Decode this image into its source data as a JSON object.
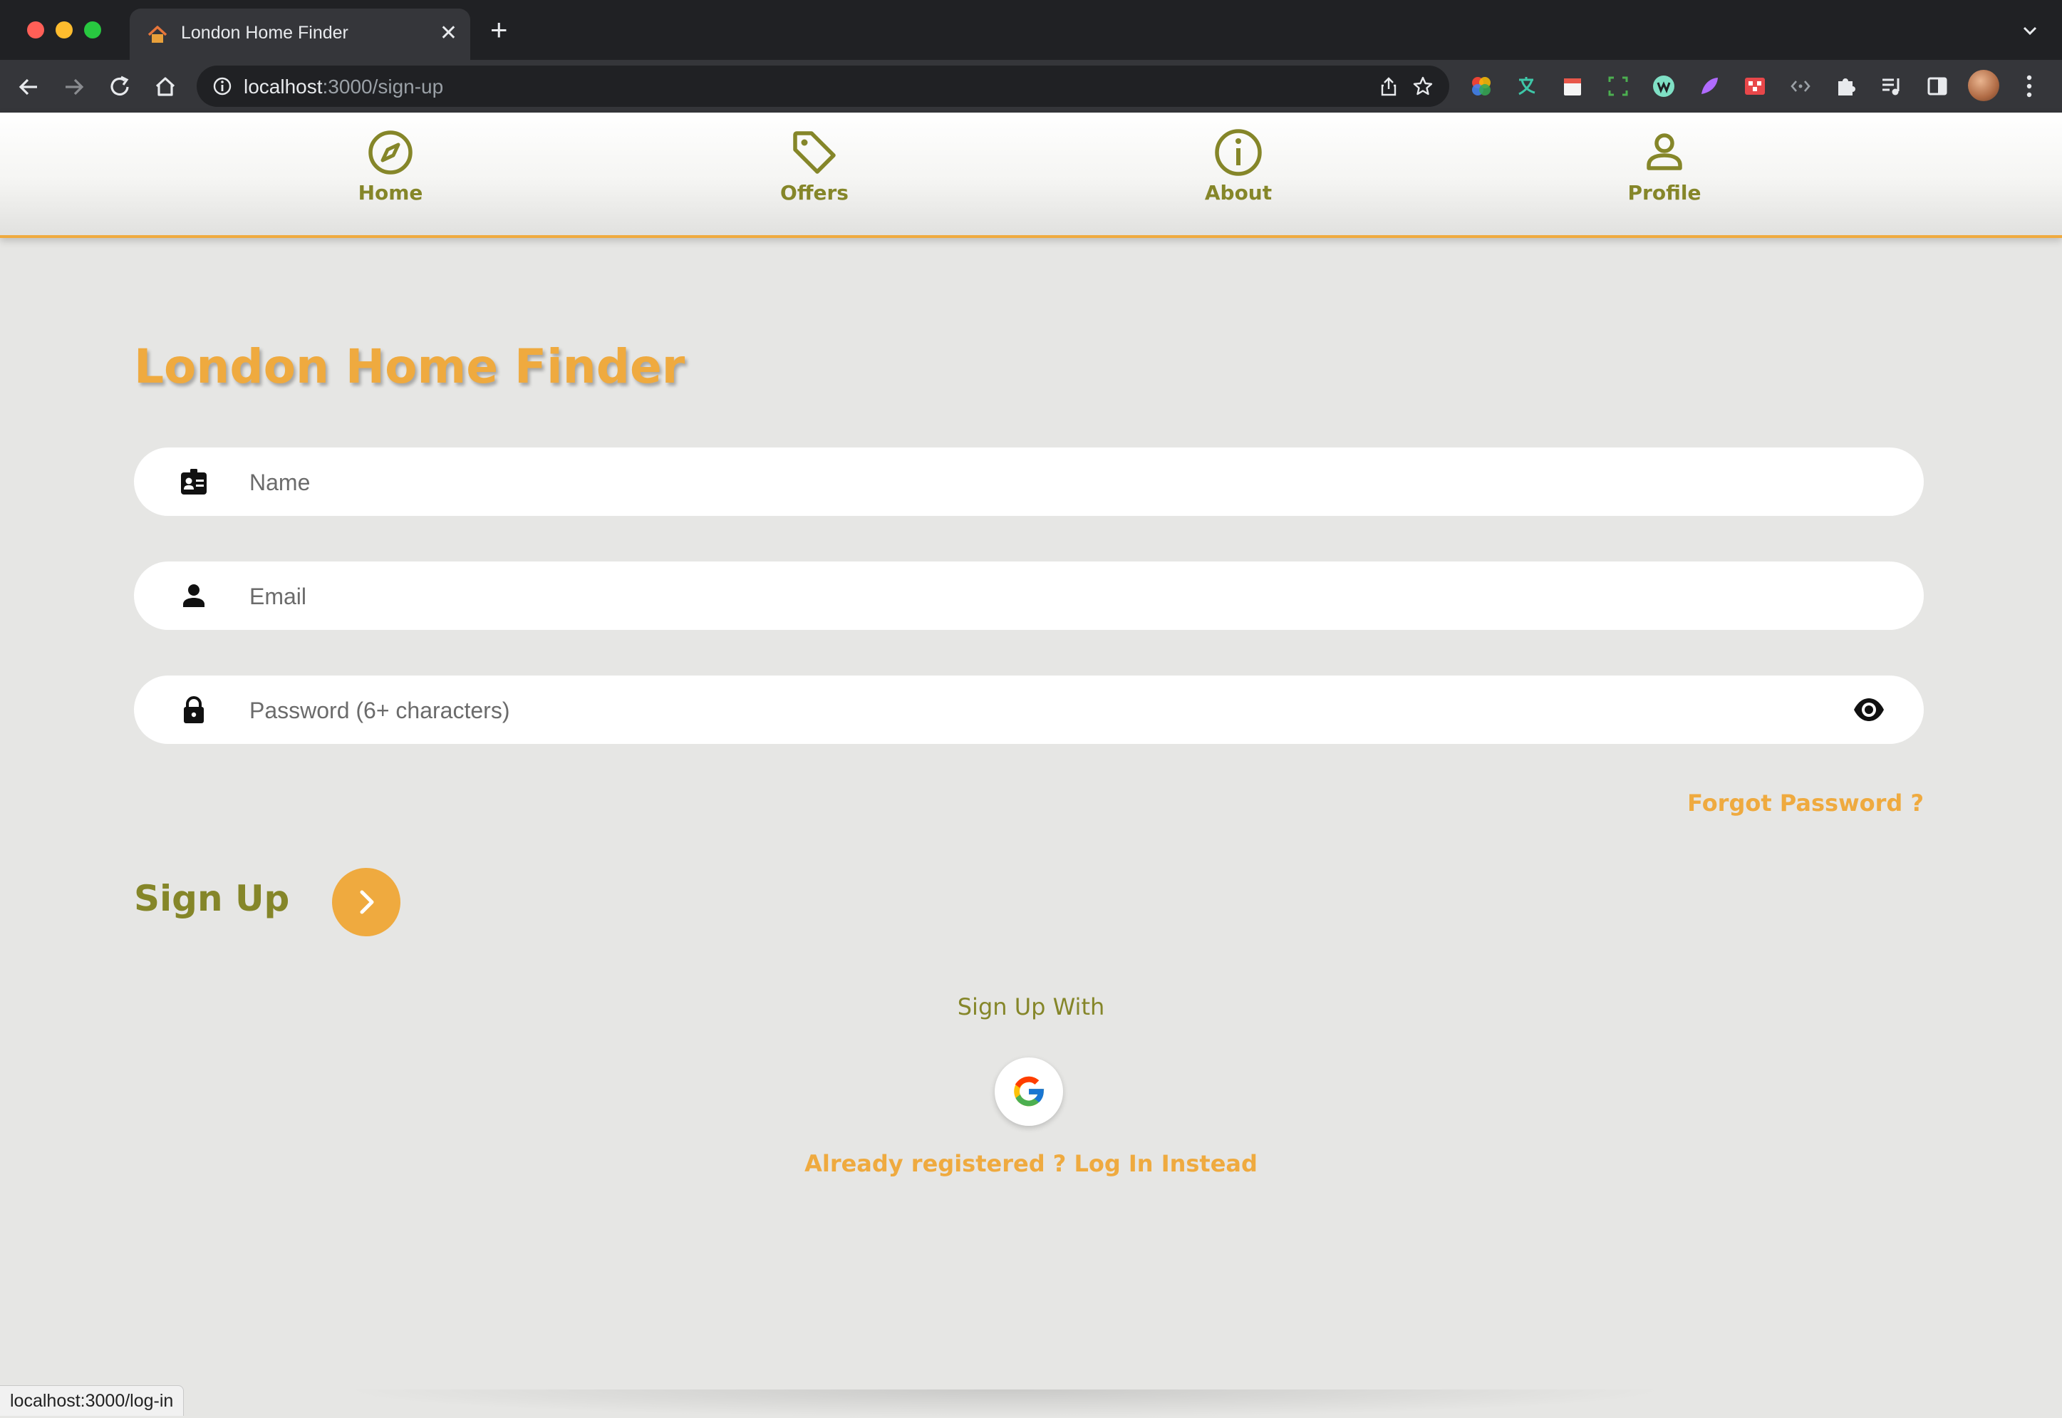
{
  "browser": {
    "tab_title": "London Home Finder",
    "tab_close": "✕",
    "new_tab": "+",
    "url_host": "localhost",
    "url_rest": ":3000/sign-up",
    "extensions": [
      "color-wheel-extension",
      "translate-extension",
      "calendar-extension",
      "screenshot-extension",
      "w-extension",
      "feather-extension",
      "red-grid-extension",
      "code-extension",
      "puzzle-extension",
      "media-control-extension",
      "side-panel-extension"
    ]
  },
  "nav": {
    "items": [
      {
        "label": "Home",
        "icon": "compass-icon"
      },
      {
        "label": "Offers",
        "icon": "tag-icon"
      },
      {
        "label": "About",
        "icon": "info-icon"
      },
      {
        "label": "Profile",
        "icon": "person-icon"
      }
    ],
    "accent_color": "#858629"
  },
  "form": {
    "title": "London Home Finder",
    "name_placeholder": "Name",
    "email_placeholder": "Email",
    "password_placeholder": "Password (6+ characters)",
    "forgot_password": "Forgot Password ?",
    "signup_label": "Sign Up",
    "signup_with": "Sign Up With",
    "login_link": "Already registered ? Log In Instead"
  },
  "status_bar": "localhost:3000/log-in",
  "colors": {
    "primary_orange": "#efaa3f",
    "olive": "#858629",
    "background": "#e6e6e4"
  }
}
